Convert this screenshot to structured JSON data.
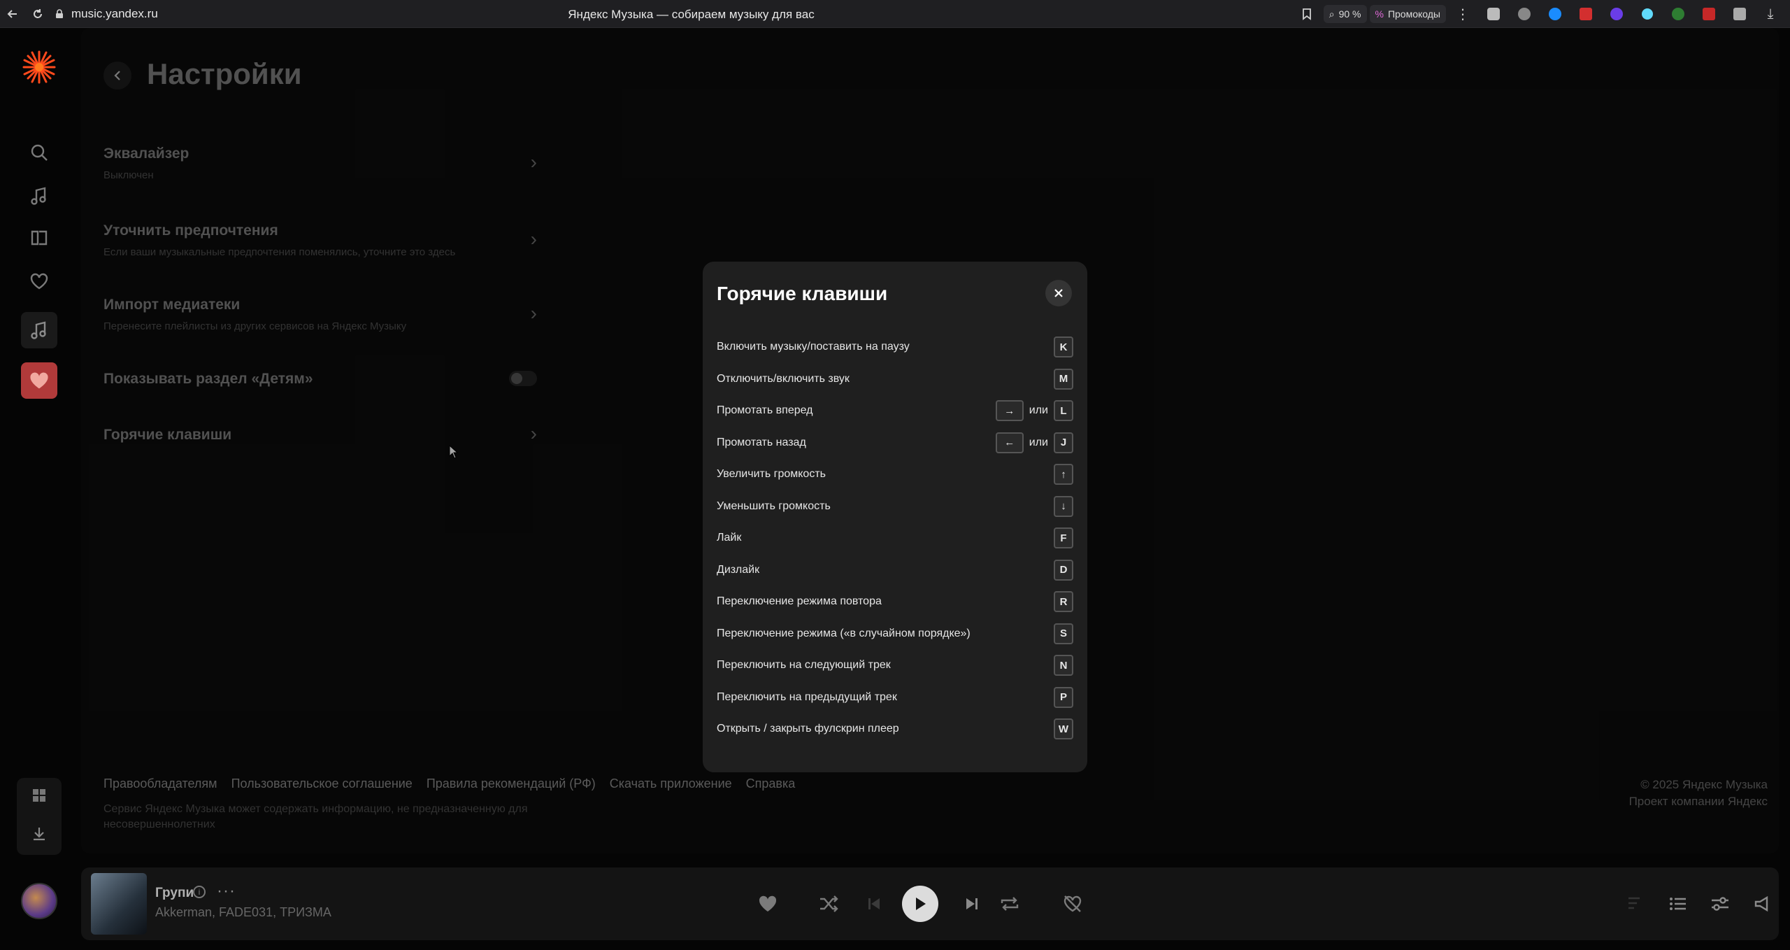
{
  "browser": {
    "url": "music.yandex.ru",
    "tab_title": "Яндекс Музыка — собираем музыку для вас",
    "zoom": "90 %",
    "promo": "Промокоды"
  },
  "settings": {
    "title": "Настройки",
    "rows": [
      {
        "title": "Эквалайзер",
        "subtitle": "Выключен"
      },
      {
        "title": "Уточнить предпочтения",
        "subtitle": "Если ваши музыкальные предпочтения поменялись, уточните это здесь"
      },
      {
        "title": "Импорт медиатеки",
        "subtitle": "Перенесите плейлисты из других сервисов на Яндекс Музыку"
      },
      {
        "title": "Показывать раздел «Детям»"
      },
      {
        "title": "Горячие клавиши"
      }
    ]
  },
  "footer": {
    "links": [
      "Правообладателям",
      "Пользовательское соглашение",
      "Правила рекомендаций (РФ)",
      "Скачать приложение",
      "Справка"
    ],
    "note": "Сервис Яндекс Музыка может содержать информацию, не предназначенную для несовершеннолетних",
    "copyright": "© 2025  Яндекс Музыка",
    "company": "Проект компании Яндекс"
  },
  "player": {
    "title": "Групи",
    "artists": "Akkerman, FADE031, ТРИЗМА"
  },
  "modal": {
    "title": "Горячие клавиши",
    "or_label": "или",
    "rows": [
      {
        "label": "Включить музыку/поставить на паузу",
        "key": "K"
      },
      {
        "label": "Отключить/включить звук",
        "key": "M"
      },
      {
        "label": "Промотать вперед",
        "alt": "→",
        "key": "L"
      },
      {
        "label": "Промотать назад",
        "alt": "←",
        "key": "J"
      },
      {
        "label": "Увеличить громкость",
        "key": "↑"
      },
      {
        "label": "Уменьшить громкость",
        "key": "↓"
      },
      {
        "label": "Лайк",
        "key": "F"
      },
      {
        "label": "Дизлайк",
        "key": "D"
      },
      {
        "label": "Переключение режима повтора",
        "key": "R"
      },
      {
        "label": "Переключение режима («в случайном порядке»)",
        "key": "S"
      },
      {
        "label": "Переключить на следующий трек",
        "key": "N"
      },
      {
        "label": "Переключить на предыдущий трек",
        "key": "P"
      },
      {
        "label": "Открыть / закрыть фулскрин плеер",
        "key": "W"
      }
    ]
  }
}
